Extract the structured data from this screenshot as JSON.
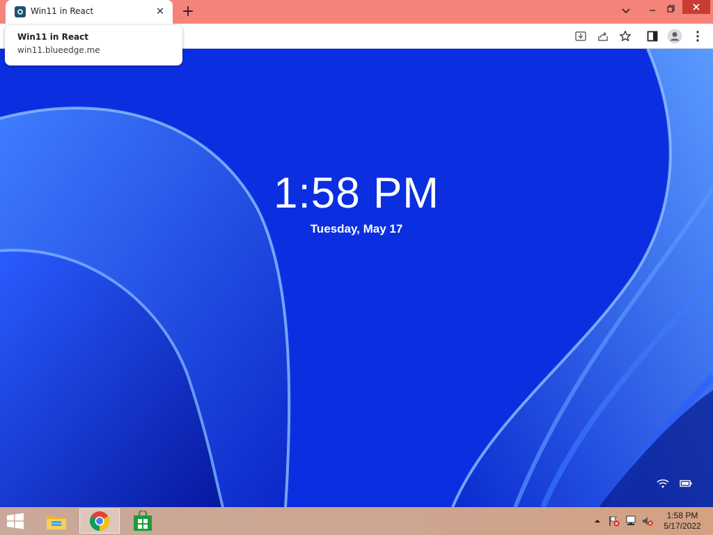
{
  "browser": {
    "tab": {
      "title": "Win11 in React",
      "close_glyph": "✕",
      "favicon": "win11-app-icon"
    },
    "new_tab_glyph": "+",
    "window_controls": {
      "tab_search": "chevron-down-icon",
      "minimize": "minimize-icon",
      "restore": "restore-icon",
      "close": "close-icon"
    },
    "toolbar_icons": [
      "install-app-icon",
      "share-icon",
      "bookmark-star-icon",
      "side-panel-icon",
      "profile-icon",
      "kebab-menu-icon"
    ],
    "tooltip": {
      "title": "Win11 in React",
      "url": "win11.blueedge.me"
    },
    "colors": {
      "tabstrip": "#f4847a",
      "close_button": "#c83c32"
    }
  },
  "lockscreen": {
    "time": "1:58 PM",
    "date": "Tuesday, May 17",
    "status_icons": [
      "wifi-icon",
      "battery-icon"
    ],
    "accent": "#0a33e6"
  },
  "taskbar": {
    "apps": [
      {
        "name": "file-explorer",
        "active": false
      },
      {
        "name": "google-chrome",
        "active": true
      },
      {
        "name": "store",
        "active": false
      }
    ],
    "tray": {
      "icons": [
        "show-hidden-icons-icon",
        "action-center-flag-icon",
        "network-icon",
        "volume-muted-icon"
      ],
      "time": "1:58 PM",
      "date": "5/17/2022"
    }
  }
}
